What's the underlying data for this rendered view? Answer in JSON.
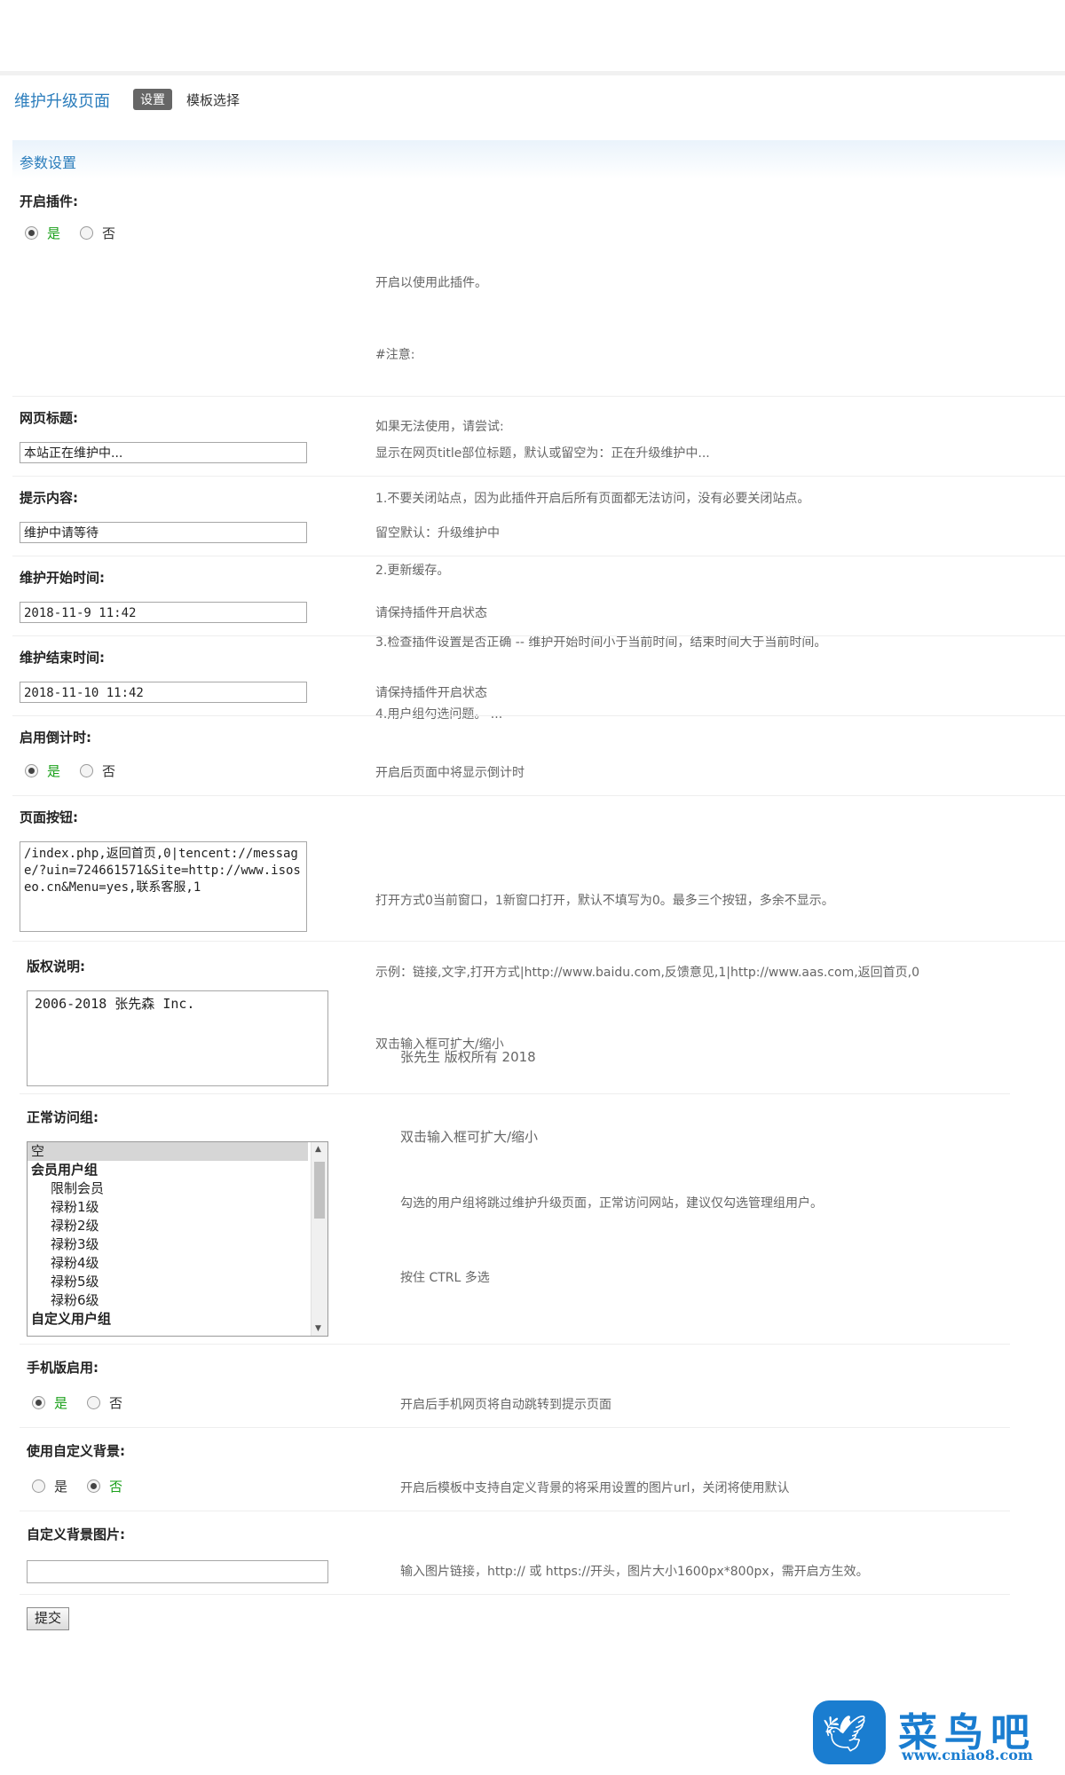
{
  "header": {
    "title": "维护升级页面",
    "tabs": [
      {
        "label": "设置"
      },
      {
        "label": "模板选择"
      }
    ]
  },
  "section": {
    "title": "参数设置"
  },
  "fields": {
    "enable_plugin": {
      "label": "开启插件:",
      "options": [
        "是",
        "否"
      ],
      "selected": "是",
      "desc": [
        "开启以使用此插件。",
        "#注意:",
        "如果无法使用，请尝试:",
        "1.不要关闭站点，因为此插件开启后所有页面都无法访问，没有必要关闭站点。",
        "2.更新缓存。",
        "3.检查插件设置是否正确 -- 维护开始时间小于当前时间，结束时间大于当前时间。",
        "4.用户组勾选问题。 ..."
      ]
    },
    "page_title": {
      "label": "网页标题:",
      "value": "本站正在维护中...",
      "desc": "显示在网页title部位标题，默认或留空为：正在升级维护中..."
    },
    "prompt": {
      "label": "提示内容:",
      "value": "维护中请等待",
      "desc": "留空默认：升级维护中"
    },
    "start_time": {
      "label": "维护开始时间:",
      "value": "2018-11-9 11:42",
      "desc": "请保持插件开启状态"
    },
    "end_time": {
      "label": "维护结束时间:",
      "value": "2018-11-10 11:42",
      "desc": "请保持插件开启状态"
    },
    "countdown": {
      "label": "启用倒计时:",
      "options": [
        "是",
        "否"
      ],
      "selected": "是",
      "desc": "开启后页面中将显示倒计时"
    },
    "buttons": {
      "label": "页面按钮:",
      "value": "/index.php,返回首页,0|tencent://message/?uin=724661571&Site=http://www.isoseo.cn&Menu=yes,联系客服,1",
      "desc": [
        "打开方式0当前窗口，1新窗口打开，默认不填写为0。最多三个按钮，多余不显示。",
        "示例：链接,文字,打开方式|http://www.baidu.com,反馈意见,1|http://www.aas.com,返回首页,0",
        "双击输入框可扩大/缩小"
      ]
    },
    "copyright": {
      "label": "版权说明:",
      "value": "2006-2018 张先森 Inc.",
      "desc": [
        "张先生 版权所有 2018",
        "双击输入框可扩大/缩小"
      ]
    },
    "access_groups": {
      "label": "正常访问组:",
      "items": [
        {
          "text": "空",
          "type": "sel"
        },
        {
          "text": "会员用户组",
          "type": "grp"
        },
        {
          "text": "限制会员",
          "type": "ind"
        },
        {
          "text": "禄粉1级",
          "type": "ind"
        },
        {
          "text": "禄粉2级",
          "type": "ind"
        },
        {
          "text": "禄粉3级",
          "type": "ind"
        },
        {
          "text": "禄粉4级",
          "type": "ind"
        },
        {
          "text": "禄粉5级",
          "type": "ind"
        },
        {
          "text": "禄粉6级",
          "type": "ind"
        },
        {
          "text": "自定义用户组",
          "type": "grp"
        }
      ],
      "desc": [
        "勾选的用户组将跳过维护升级页面，正常访问网站，建议仅勾选管理组用户。",
        "按住 CTRL 多选"
      ]
    },
    "mobile": {
      "label": "手机版启用:",
      "options": [
        "是",
        "否"
      ],
      "selected": "是",
      "desc": "开启后手机网页将自动跳转到提示页面"
    },
    "custom_bg": {
      "label": "使用自定义背景:",
      "options": [
        "是",
        "否"
      ],
      "selected": "否",
      "desc": "开启后模板中支持自定义背景的将采用设置的图片url，关闭将使用默认"
    },
    "bg_image": {
      "label": "自定义背景图片:",
      "value": "",
      "desc": "输入图片链接，http:// 或 https://开头，图片大小1600px*800px，需开启方生效。"
    }
  },
  "submit_label": "提交",
  "logo": {
    "brand": "菜鸟吧",
    "url": "www.cniao8.com"
  }
}
